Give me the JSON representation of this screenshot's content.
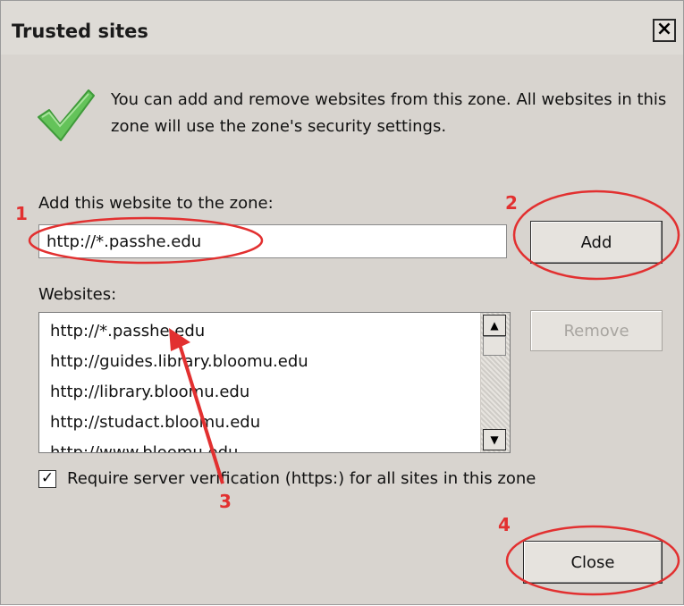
{
  "window": {
    "title": "Trusted sites",
    "close_glyph": "✕"
  },
  "intro": {
    "icon": "green-checkmark-icon",
    "text": "You can add and remove websites from this zone. All websites in this zone will use the zone's security settings."
  },
  "add_section": {
    "label": "Add this website to the zone:",
    "input_value": "http://*.passhe.edu",
    "add_button": "Add"
  },
  "websites_section": {
    "label": "Websites:",
    "items": [
      "http://*.passhe.edu",
      "http://guides.library.bloomu.edu",
      "http://library.bloomu.edu",
      "http://studact.bloomu.edu",
      "http://www.bloomu.edu"
    ],
    "remove_button": "Remove"
  },
  "verification": {
    "checked": true,
    "label": "Require server verification (https:) for all sites in this zone"
  },
  "footer": {
    "close_button": "Close"
  },
  "annotations": {
    "color": "#e23030",
    "markers": [
      "1",
      "2",
      "3",
      "4"
    ]
  }
}
